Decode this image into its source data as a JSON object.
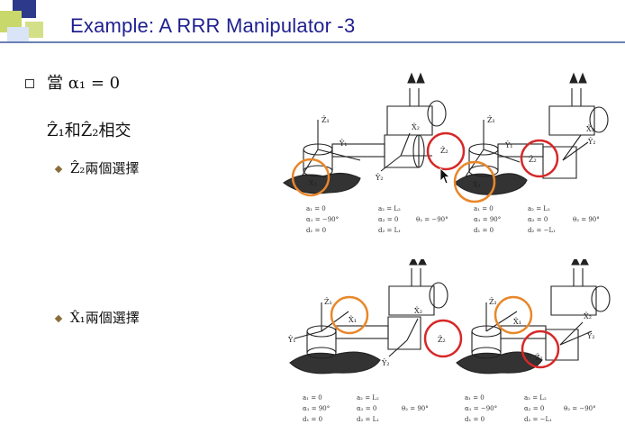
{
  "slide": {
    "title": "Example: A RRR Manipulator -3",
    "bullet1": "當 α₁ = 0",
    "line2": "Ẑ₁和Ẑ₂相交",
    "sub1": "Ẑ₂兩個選擇",
    "sub2": "X̂₁兩個選擇"
  },
  "colors": {
    "title": "#1f1f8f",
    "orange": "#e8872a",
    "red": "#d62828"
  },
  "params_top": {
    "left": {
      "c1": [
        "a₁ = 0",
        "α₁ = −90°",
        "d₁ = 0"
      ],
      "c2": [
        "a₂ = L₂",
        "α₂ = 0",
        "d₂ = L₁"
      ],
      "c3": [
        "θ₂ = −90°"
      ]
    },
    "right": {
      "c1": [
        "a₁ = 0",
        "α₁ = 90°",
        "d₁ = 0"
      ],
      "c2": [
        "a₂ = L₂",
        "α₂ = 0",
        "d₂ = −L₁"
      ],
      "c3": [
        "θ₂ = 90°"
      ]
    }
  },
  "params_bottom": {
    "left": {
      "c1": [
        "a₁ = 0",
        "α₁ = 90°",
        "d₁ = 0"
      ],
      "c2": [
        "a₂ = L₂",
        "α₂ = 0",
        "d₂ = L₁"
      ],
      "c3": [
        "θ₂ = 90°"
      ]
    },
    "right": {
      "c1": [
        "a₁ = 0",
        "α₁ = −90°",
        "d₁ = 0"
      ],
      "c2": [
        "a₂ = L₂",
        "α₂ = 0",
        "d₂ = −L₁"
      ],
      "c3": [
        "θ₂ = −90°"
      ]
    }
  },
  "axis_labels": {
    "z1": "Ẑ₁",
    "x1": "X̂₁",
    "y1": "Ŷ₁",
    "x2": "X̂₂",
    "y2": "Ŷ₂",
    "z2": "Ẑ₂"
  }
}
